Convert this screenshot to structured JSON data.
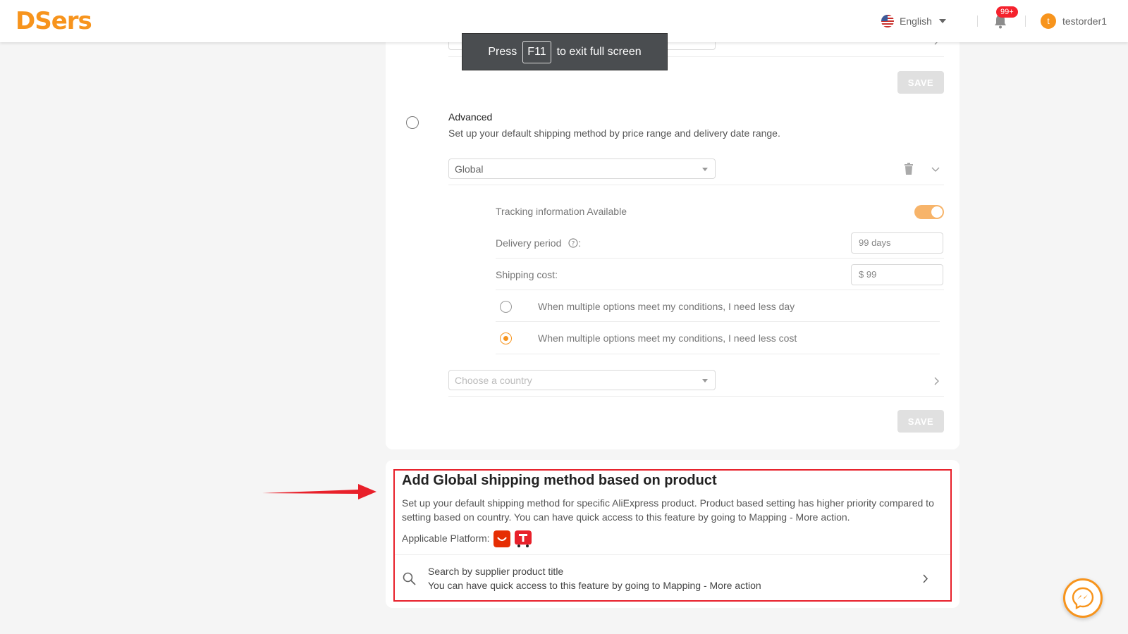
{
  "header": {
    "logo": "DSers",
    "language": "English",
    "notifications_badge": "99+",
    "avatar_initial": "t",
    "username": "testorder1"
  },
  "fullscreen_notice": {
    "prefix": "Press",
    "key": "F11",
    "suffix": "to exit full screen"
  },
  "basic_section": {
    "save_label": "SAVE"
  },
  "advanced": {
    "title": "Advanced",
    "description": "Set up your default shipping method by price range and delivery date range.",
    "country_select_value": "Global",
    "tracking_label": "Tracking information Available",
    "tracking_enabled": true,
    "delivery_period_label": "Delivery period",
    "delivery_period_value": "99 days",
    "shipping_cost_label": "Shipping cost",
    "shipping_cost_value": "$ 99",
    "option_less_day": "When multiple options meet my conditions, I need less day",
    "option_less_cost": "When multiple options meet my conditions, I need less cost",
    "selected_option": "less_cost",
    "choose_country_placeholder": "Choose a country",
    "save_label": "SAVE"
  },
  "product_section": {
    "title": "Add Global shipping method based on product",
    "description": "Set up your default shipping method for specific AliExpress product. Product based setting has higher priority compared to setting based on country. You can have quick access to this feature by going to Mapping - More action.",
    "platform_label": "Applicable Platform:",
    "search_title": "Search by supplier product title",
    "search_subtitle": "You can have quick access to this feature by going to Mapping - More action"
  },
  "colors": {
    "accent": "#f7941d",
    "highlight_box": "#e8202a"
  }
}
